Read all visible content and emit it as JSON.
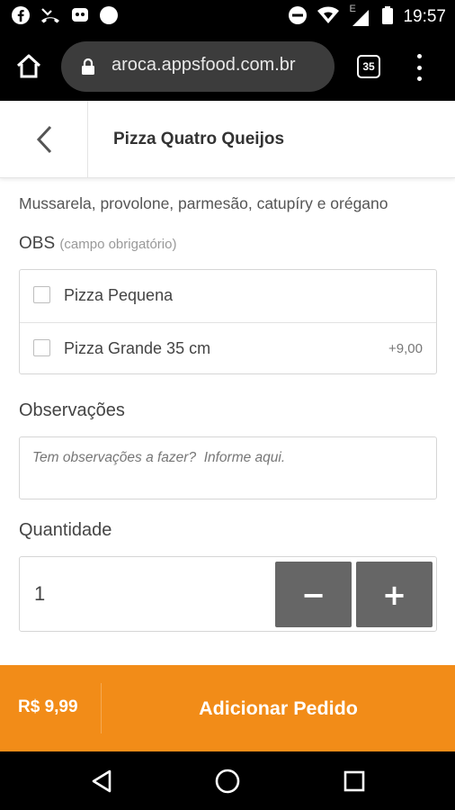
{
  "status_bar": {
    "time": "19:57",
    "network_label": "E",
    "icons": [
      "facebook-icon",
      "missed-call-icon",
      "chat-icon",
      "circle-notification-icon",
      "do-not-disturb-icon",
      "wifi-icon",
      "signal-icon",
      "battery-icon"
    ]
  },
  "browser": {
    "url": "aroca.appsfood.com.br",
    "tab_count": "35"
  },
  "header": {
    "title": "Pizza Quatro Queijos"
  },
  "product": {
    "description": "Mussarela, provolone, parmesão, catupíry e orégano"
  },
  "obs": {
    "label": "OBS",
    "required_note": "(campo obrigatório)",
    "options": [
      {
        "label": "Pizza Pequena",
        "price": "",
        "checked": false
      },
      {
        "label": "Pizza Grande 35 cm",
        "price": "+9,00",
        "checked": false
      }
    ]
  },
  "observacoes": {
    "label": "Observações",
    "placeholder": "Tem observações a fazer?  Informe aqui."
  },
  "quantity": {
    "label": "Quantidade",
    "value": "1",
    "minus_label": "−",
    "plus_label": "+"
  },
  "order_bar": {
    "price": "R$ 9,99",
    "add_label": "Adicionar Pedido",
    "color": "#f28c18"
  }
}
